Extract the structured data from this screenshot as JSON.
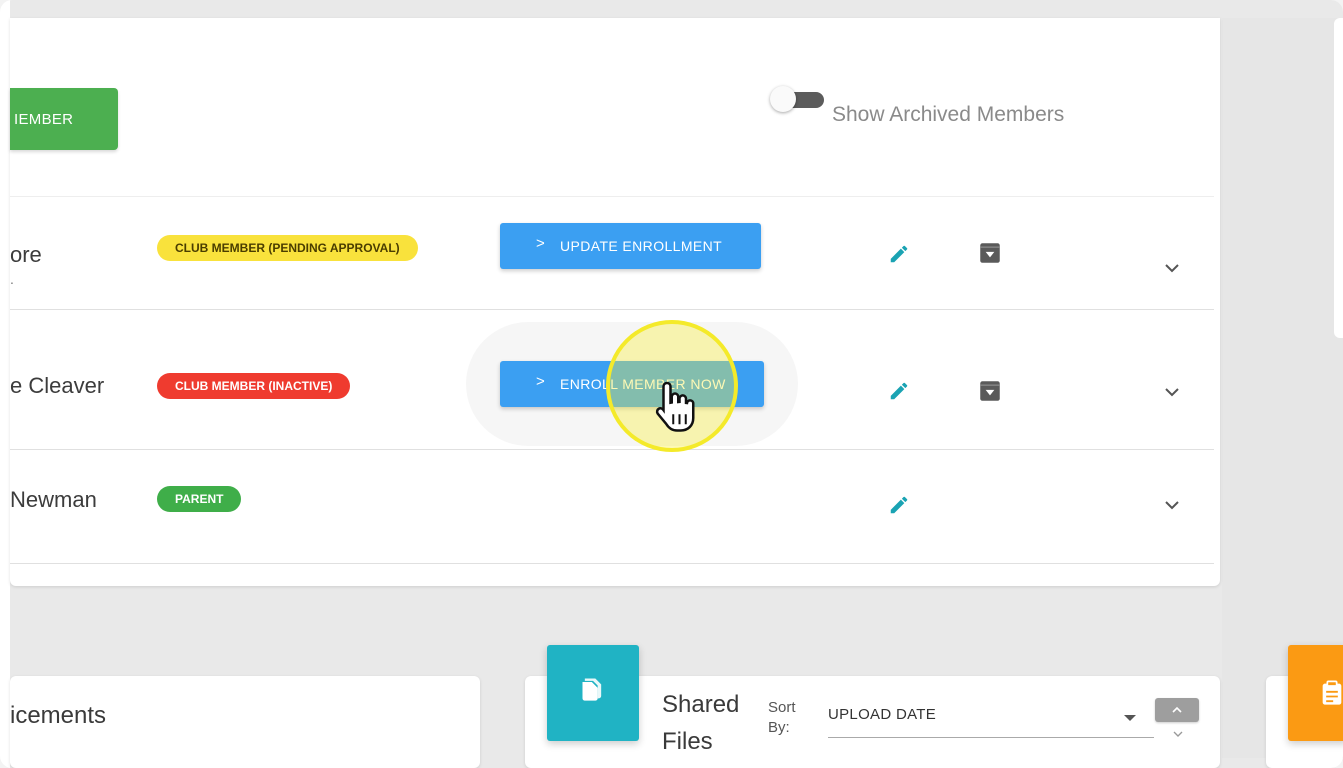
{
  "header": {
    "add_member_label": "IEMBER",
    "archived_toggle_label": "Show Archived Members",
    "archived_toggle_on": false
  },
  "members": [
    {
      "name": "ore",
      "subname": ".",
      "status_badge": "CLUB MEMBER (PENDING APPROVAL)",
      "badge_color": "#f9e23c",
      "action_label": "UPDATE ENROLLMENT"
    },
    {
      "name": "e Cleaver",
      "status_badge": "CLUB MEMBER (INACTIVE)",
      "badge_color": "#ef3b2f",
      "action_label": "ENROLL MEMBER NOW"
    },
    {
      "name": "Newman",
      "status_badge": "PARENT",
      "badge_color": "#3fae49"
    }
  ],
  "icons": {
    "edit": "pencil-icon",
    "archive": "archive-box-icon",
    "expand": "chevron-down-icon",
    "files": "files-icon",
    "clipboard": "clipboard-icon"
  },
  "announcements": {
    "title": "icements"
  },
  "shared_files": {
    "title_line1": "Shared",
    "title_line2": "Files",
    "sort_label_line1": "Sort",
    "sort_label_line2": "By:",
    "sort_value": "UPLOAD DATE"
  },
  "colors": {
    "primary_button": "#3b9ff2",
    "add_member": "#4caf50",
    "files_tile": "#20b3c4",
    "orange_tile": "#fb9a13",
    "edit_icon": "#1aa3b3"
  }
}
